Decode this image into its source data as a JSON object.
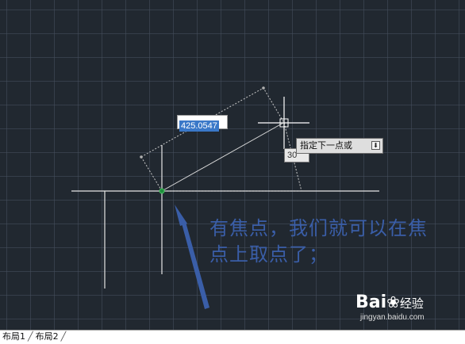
{
  "drawing": {
    "length_input": "425.0547",
    "angle_input": "30",
    "prompt": "指定下一点或",
    "prompt_dropdown_icon": "dropdown-arrow-icon"
  },
  "annotation": {
    "text_line1": "有焦点，我们就可以在焦",
    "text_line2": "点上取点了；",
    "color": "#3a5ea8"
  },
  "watermark": {
    "brand": "Bai",
    "brand_suffix": "经验",
    "url": "jingyan.baidu.com"
  },
  "layout_tabs": {
    "tab1": "布局1",
    "tab2": "布局2"
  }
}
